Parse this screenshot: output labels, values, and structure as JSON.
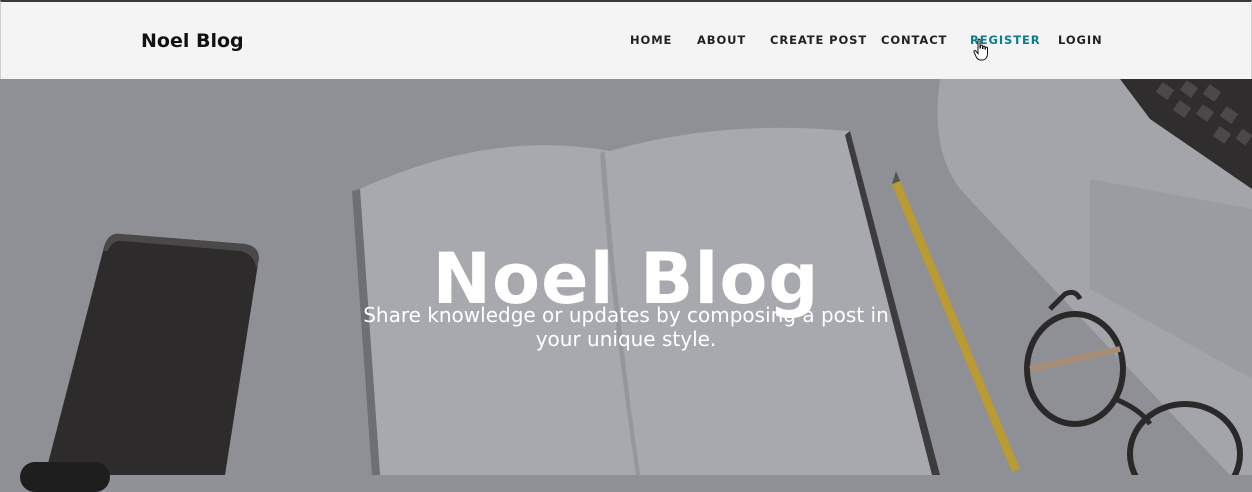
{
  "header": {
    "brand": "Noel Blog",
    "nav": [
      {
        "label": "HOME"
      },
      {
        "label": "ABOUT"
      },
      {
        "label": "CREATE POST"
      },
      {
        "label": "CONTACT"
      },
      {
        "label": "REGISTER"
      },
      {
        "label": "LOGIN"
      }
    ],
    "active_nav": "REGISTER"
  },
  "hero": {
    "title": "Noel Blog",
    "subtitle": "Share knowledge or updates by composing a post in your unique style."
  },
  "colors": {
    "active_nav": "#0b7d8c",
    "header_bg": "#f4f4f4"
  },
  "icons": {
    "cursor": "hand-pointer-icon"
  }
}
